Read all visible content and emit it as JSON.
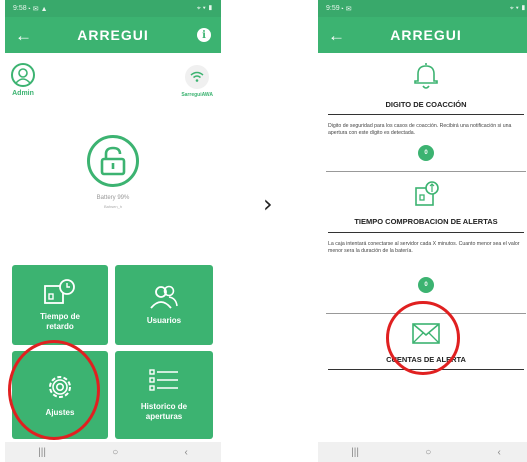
{
  "left": {
    "status_time": "9:58",
    "status_icons": "◔ ✉ ▲",
    "status_right": "⌖ ▾ ▮",
    "brand": "ARREGUI",
    "back": "←",
    "info": "i",
    "admin_label": "Admin",
    "wifi_label": "SarreguiAWA",
    "battery": "Battery 99%",
    "sub_id": "Bahsen_h",
    "tiles": {
      "tiempo": "Tiempo de retardo",
      "usuarios": "Usuarios",
      "ajustes": "Ajustes",
      "historico": "Historico de aperturas"
    },
    "nav": [
      "|||",
      "○",
      "‹"
    ]
  },
  "right": {
    "status_time": "9:59",
    "status_icons": "◔ ✉",
    "status_right": "⌖ ▾ ▮",
    "brand": "ARREGUI",
    "back": "←",
    "sections": [
      {
        "title": "DIGITO DE COACCIÓN",
        "text": "Digito de seguridad para los casos de coacción. Recibirá una notificación si una apertura con este dígito es detectada.",
        "value": "0"
      },
      {
        "title": "TIEMPO COMPROBACION DE ALERTAS",
        "text": "La caja intentará conectarse al servidor cada X minutos. Cuanto menor sea el valor menor sera la duración de la batería.",
        "value": "0"
      },
      {
        "title": "CUENTAS DE ALERTA"
      }
    ],
    "nav": [
      "|||",
      "○",
      "‹"
    ]
  },
  "arrow": "›",
  "colors": {
    "green": "#3cb371",
    "red": "#e02020"
  }
}
